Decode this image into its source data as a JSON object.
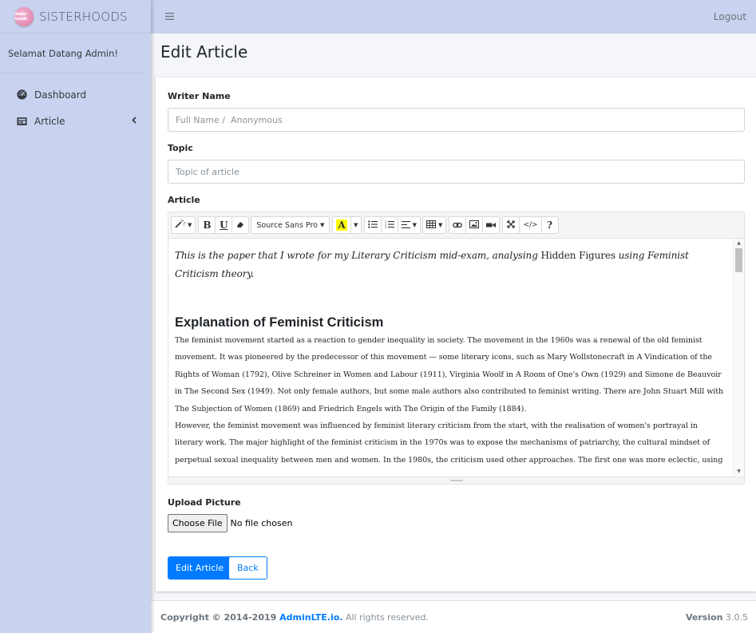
{
  "brand": {
    "name": "SISTERHOODS",
    "logo_text": "Sister hoods"
  },
  "sidebar": {
    "welcome": "Selamat Datang Admin!",
    "items": [
      {
        "label": "Dashboard",
        "icon": "tachometer-icon"
      },
      {
        "label": "Article",
        "icon": "newspaper-icon"
      }
    ]
  },
  "topbar": {
    "logout": "Logout"
  },
  "page": {
    "title": "Edit Article"
  },
  "form": {
    "writer_label": "Writer Name",
    "writer_placeholder": "Full Name /  Anonymous",
    "topic_label": "Topic",
    "topic_placeholder": "Topic of article",
    "article_label": "Article",
    "upload_label": "Upload Picture",
    "file_button": "Choose File",
    "file_status": "No file chosen",
    "submit_label": "Edit Article",
    "back_label": "Back"
  },
  "editor": {
    "font_name": "Source Sans Pro",
    "intro_a": "This is the paper that I wrote for my Literary Criticism mid-exam, analysing ",
    "intro_b": "Hidden Figures",
    "intro_c": " using Feminist Criticism theory.",
    "heading": "Explanation of Feminist Criticism",
    "para1": "The feminist movement started as a reaction to gender inequality in society. The movement in the 1960s was a renewal of the old feminist movement. It was pioneered by the predecessor of this movement — some literary icons, such as Mary Wollstonecraft in A Vindication of the Rights of Woman (1792), Olive Schreiner in Women and Labour (1911), Virginia Woolf in A Room of One's Own (1929) and Simone de Beauvoir in The Second Sex (1949). Not only female authors, but some male authors also contributed to feminist writing. There are John Stuart Mill with The Subjection of Women (1869) and Friedrich Engels with The Origin of the Family (1884).",
    "para2": "However, the feminist movement was influenced by feminist literary criticism from the start, with the realisation of women's portrayal in literary work. The major highlight of the feminist criticism in the 1970s was to expose the mechanisms of patriarchy, the cultural mindset of perpetual sexual inequality between men and women. In the 1980s, the criticism used other approaches. The first one was more eclectic, using"
  },
  "footer": {
    "copyright_prefix": "Copyright © 2014-2019 ",
    "link": "AdminLTE.io.",
    "suffix": " All rights reserved.",
    "version_label": "Version",
    "version": "3.0.5"
  },
  "colors": {
    "sidebar_bg": "#c9d2ee",
    "primary": "#007bff",
    "highlight": "#ffff00"
  }
}
